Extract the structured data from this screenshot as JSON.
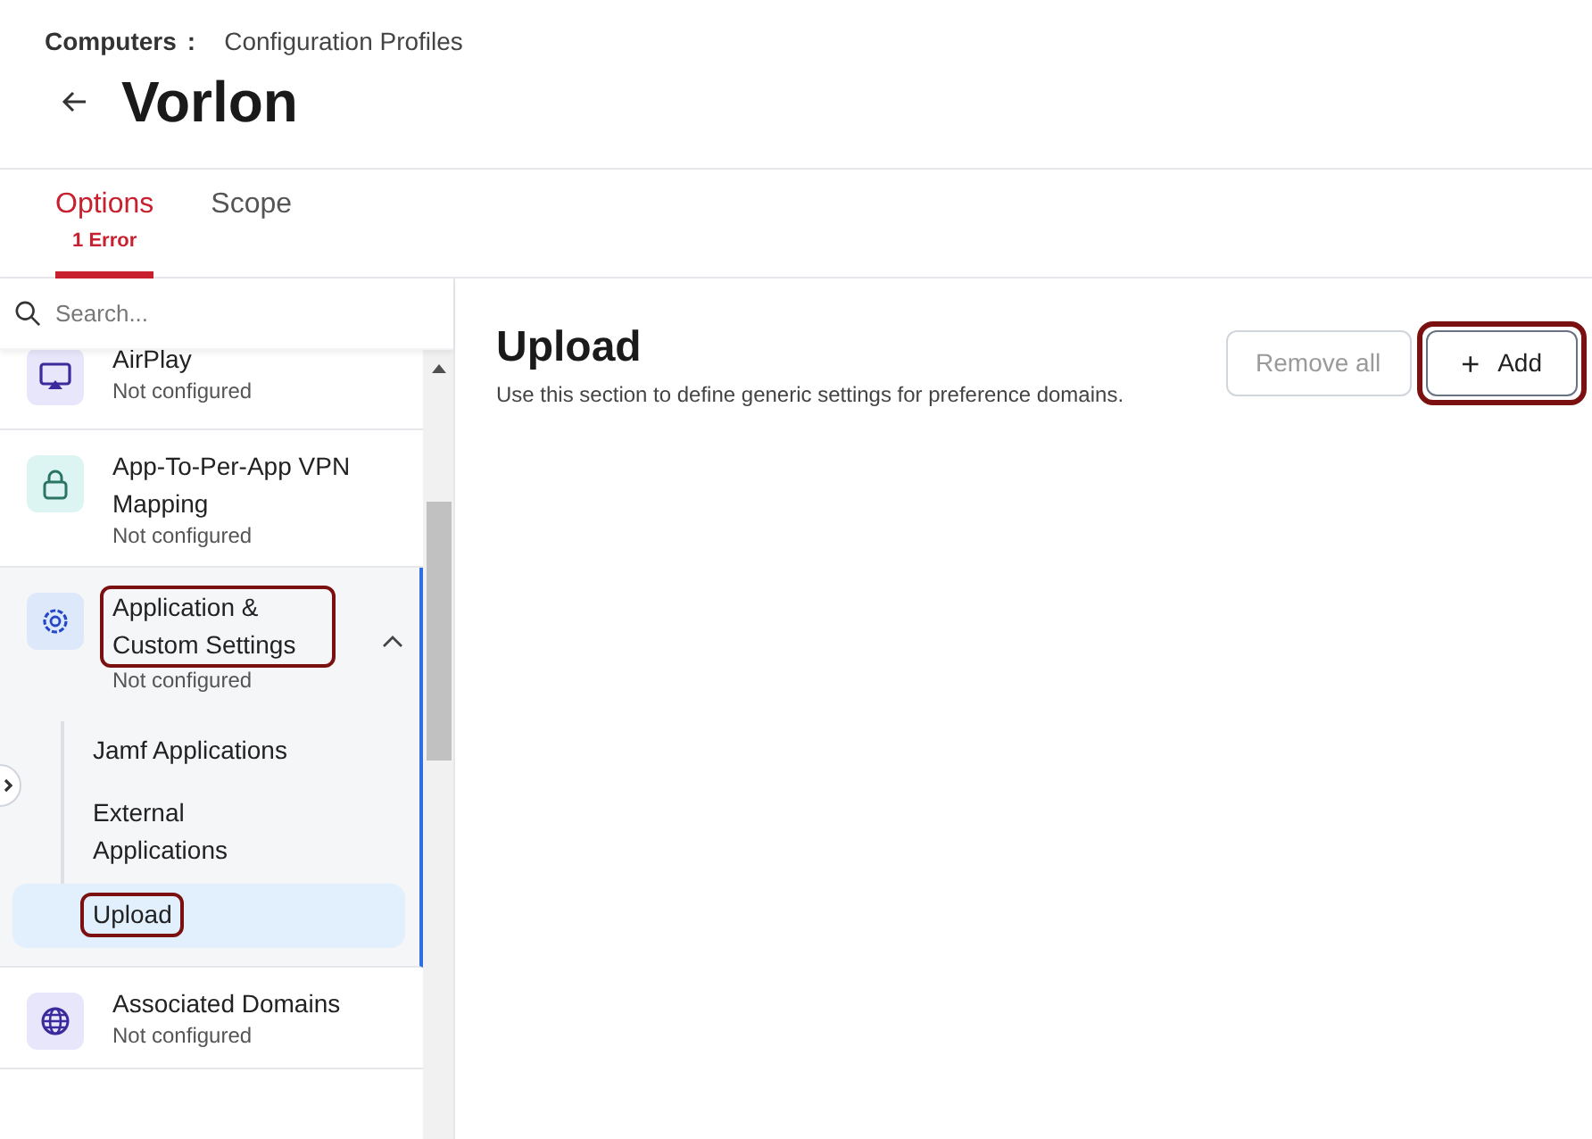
{
  "breadcrumb": {
    "parent": "Computers",
    "separator": ":",
    "current": "Configuration Profiles"
  },
  "title": "Vorlon",
  "tabs": [
    {
      "label": "Options",
      "badge": "1 Error",
      "selected": true
    },
    {
      "label": "Scope",
      "selected": false
    }
  ],
  "sidebar": {
    "search": {
      "placeholder": "Search..."
    },
    "items": [
      {
        "label": "AirPlay",
        "status": "Not configured",
        "highlighted": false
      },
      {
        "label": "App-To-Per-App VPN Mapping",
        "status": "Not configured",
        "highlighted": false
      },
      {
        "label": "Application & Custom Settings",
        "status": "Not configured",
        "expanded": true,
        "highlighted": true,
        "children": [
          {
            "label": "Jamf Applications",
            "selected": false,
            "highlighted": false
          },
          {
            "label": "External Applications",
            "selected": false,
            "highlighted": false
          },
          {
            "label": "Upload",
            "selected": true,
            "highlighted": true
          }
        ]
      },
      {
        "label": "Associated Domains",
        "status": "Not configured",
        "highlighted": false
      }
    ]
  },
  "content": {
    "title": "Upload",
    "description": "Use this section to define generic settings for preference domains.",
    "buttons": [
      {
        "label": "Remove all",
        "disabled": true,
        "highlighted": false
      },
      {
        "label": "Add",
        "icon": "+",
        "disabled": false,
        "highlighted": true
      }
    ]
  }
}
